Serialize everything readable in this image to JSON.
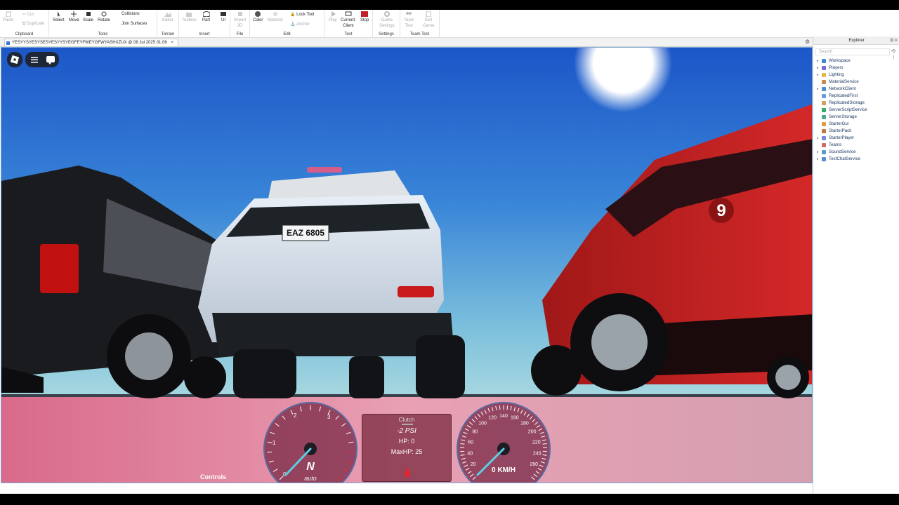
{
  "ribbon": {
    "clipboard": {
      "paste": "Paste",
      "cut": "Cut",
      "duplicate": "Duplicate",
      "label": "Clipboard"
    },
    "tools": {
      "select": "Select",
      "move": "Move",
      "scale": "Scale",
      "rotate": "Rotate",
      "collisions": "Collisions",
      "join_surfaces": "Join Surfaces",
      "label": "Tools"
    },
    "terrain": {
      "editor": "Editor",
      "label": "Terrain"
    },
    "insert": {
      "toolbox": "Toolbox",
      "part": "Part",
      "ui": "UI",
      "label": "Insert"
    },
    "file": {
      "import3d_line1": "Import",
      "import3d_line2": "3D",
      "label": "File"
    },
    "edit": {
      "color": "Color",
      "material": "Material",
      "lock_tool": "Lock Tool",
      "anchor": "Anchor",
      "label": "Edit"
    },
    "test": {
      "play": "Play",
      "current_line1": "Current:",
      "current_line2": "Client",
      "stop": "Stop",
      "label": "Test"
    },
    "settings": {
      "game_line1": "Game",
      "game_line2": "Settings",
      "label": "Settings"
    },
    "team_test": {
      "team_line1": "Team",
      "team_line2": "Test",
      "exit_line1": "Exit",
      "exit_line2": "Game",
      "label": "Team Test"
    }
  },
  "tab": {
    "title": "YESYYSYESYSESYESYYSYEGFEYFWEYGFWYASHXZUX @ 08 Jul 2025 01:06",
    "close": "×"
  },
  "viewport": {
    "license_plate": "EAZ 6805",
    "car_number": "9",
    "dashboard": {
      "gear": "N",
      "mode": "auto",
      "clutch_label": "Clutch",
      "boost": "-2 PSI",
      "hp": "HP: 0",
      "max_hp": "MaxHP: 25",
      "speed": "0 KM/H",
      "rpm_ticks": [
        "0",
        "1",
        "2",
        "3"
      ],
      "speed_ticks": [
        "20",
        "40",
        "60",
        "80",
        "100",
        "120",
        "140",
        "160",
        "180",
        "200",
        "220",
        "240",
        "260"
      ],
      "controls_label": "Controls"
    }
  },
  "explorer": {
    "title": "Explorer",
    "search_placeholder": "Search",
    "items": [
      {
        "label": "Workspace",
        "icon": "workspace-icon",
        "color": "#3f8ad6",
        "expandable": true
      },
      {
        "label": "Players",
        "icon": "players-icon",
        "color": "#7a6ad8",
        "expandable": true
      },
      {
        "label": "Lighting",
        "icon": "lighting-icon",
        "color": "#e8b84a",
        "expandable": true
      },
      {
        "label": "MaterialService",
        "icon": "material-service-icon",
        "color": "#c88a4a",
        "expandable": false
      },
      {
        "label": "NetworkClient",
        "icon": "network-client-icon",
        "color": "#4a8fd0",
        "expandable": true
      },
      {
        "label": "ReplicatedFirst",
        "icon": "replicated-first-icon",
        "color": "#6a9ae0",
        "expandable": false
      },
      {
        "label": "ReplicatedStorage",
        "icon": "replicated-storage-icon",
        "color": "#d0a060",
        "expandable": false
      },
      {
        "label": "ServerScriptService",
        "icon": "server-script-service-icon",
        "color": "#3aa86a",
        "expandable": false
      },
      {
        "label": "ServerStorage",
        "icon": "server-storage-icon",
        "color": "#4aa88a",
        "expandable": false
      },
      {
        "label": "StarterGui",
        "icon": "starter-gui-icon",
        "color": "#e0a040",
        "expandable": false
      },
      {
        "label": "StarterPack",
        "icon": "starter-pack-icon",
        "color": "#c07a40",
        "expandable": false
      },
      {
        "label": "StarterPlayer",
        "icon": "starter-player-icon",
        "color": "#7a8ad8",
        "expandable": true
      },
      {
        "label": "Teams",
        "icon": "teams-icon",
        "color": "#d06a6a",
        "expandable": false
      },
      {
        "label": "SoundService",
        "icon": "sound-service-icon",
        "color": "#5a9ad0",
        "expandable": true
      },
      {
        "label": "TextChatService",
        "icon": "text-chat-service-icon",
        "color": "#5a8ad0",
        "expandable": true
      }
    ]
  },
  "colors": {
    "accent": "#3a78d8",
    "stop_red": "#c0202a",
    "viewport_border": "#7fa8d8"
  }
}
